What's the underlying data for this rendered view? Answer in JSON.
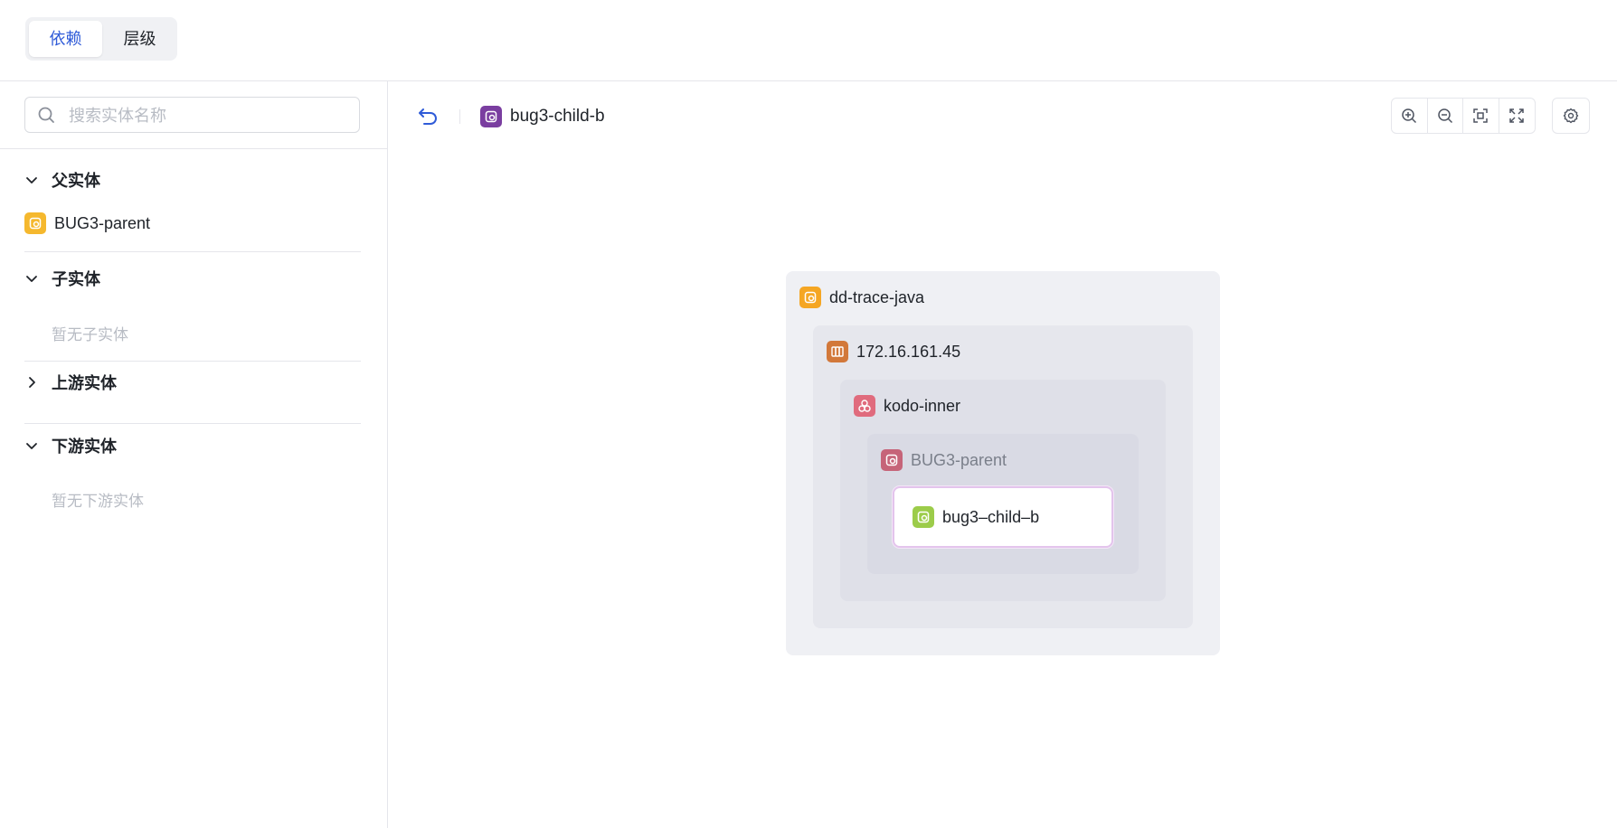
{
  "tabs": {
    "items": [
      {
        "label": "依赖",
        "active": true
      },
      {
        "label": "层级",
        "active": false
      }
    ]
  },
  "sidebar": {
    "search": {
      "placeholder": "搜索实体名称",
      "value": ""
    },
    "sections": [
      {
        "title": "父实体",
        "expanded": true,
        "items": [
          {
            "label": "BUG3-parent",
            "icon": "service-icon",
            "color": "#f5b82e"
          }
        ]
      },
      {
        "title": "子实体",
        "expanded": true,
        "empty_text": "暂无子实体"
      },
      {
        "title": "上游实体",
        "expanded": false
      },
      {
        "title": "下游实体",
        "expanded": true,
        "empty_text": "暂无下游实体"
      }
    ]
  },
  "main": {
    "breadcrumb": {
      "label": "bug3-child-b",
      "icon": "service-icon",
      "color": "#7a3ea0"
    },
    "toolbar": {
      "tools": [
        "zoom-in-icon",
        "zoom-out-icon",
        "fit-view-icon",
        "fullscreen-icon"
      ],
      "settings": "gear-icon"
    },
    "graph": {
      "nodes": [
        {
          "label": "dd-trace-java",
          "icon": "service-icon",
          "color": "#f5a623"
        },
        {
          "label": "172.16.161.45",
          "icon": "host-icon",
          "color": "#d2783a"
        },
        {
          "label": "kodo-inner",
          "icon": "cluster-icon",
          "color": "#e06b7d"
        },
        {
          "label": "BUG3-parent",
          "icon": "service-icon",
          "color": "#c66479"
        },
        {
          "label": "bug3–child–b",
          "icon": "service-icon",
          "color": "#9ccc4a",
          "selected": true
        }
      ]
    }
  },
  "colors": {
    "accent": "#2f5bd8",
    "selected_border": "#e3c4ec"
  }
}
